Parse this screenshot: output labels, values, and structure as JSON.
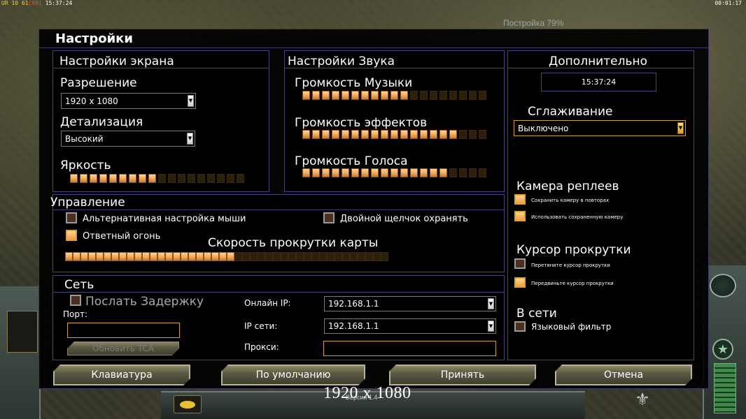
{
  "overlay": {
    "status_prefix": "UR",
    "status_val_a": "10",
    "status_val_b": "61",
    "status_val_c": "[60]",
    "status_clock": "15:37:24",
    "game_timer": "00:01:17",
    "build_status": "Постройка 79%",
    "version_text": "Версия 1.4",
    "resolution_caption": "1920 x 1080"
  },
  "dialog": {
    "title": "Настройки"
  },
  "screen": {
    "title": "Настройки экрана",
    "resolution_label": "Разрешение",
    "resolution_value": "1920 x 1080",
    "detail_label": "Детализация",
    "detail_value": "Высокий",
    "brightness_label": "Яркость",
    "brightness_level": 0.5
  },
  "sound": {
    "title": "Настройки Звука",
    "music_label": "Громкость Музыки",
    "music_level": 0.58,
    "effects_label": "Громкость эффектов",
    "effects_level": 0.84,
    "voice_label": "Громкость Голоса",
    "voice_level": 0.79
  },
  "advanced": {
    "title": "Дополнительно",
    "clock": "15:37:24",
    "antialias_label": "Сглаживание",
    "antialias_value": "Выключено",
    "replay_camera_title": "Камера реплеев",
    "replay_save_label": "Сохранить камеру в повторах",
    "replay_use_label": "Использовать сохраненную камеру",
    "scroll_cursor_title": "Курсор прокрутки",
    "scroll_cursor_drag_label": "Перетяните курсор прокрутки",
    "scroll_cursor_move_label": "Передвиньте курсор прокрутки",
    "online_title": "В сети",
    "language_filter_label": "Языковый фильтр"
  },
  "controls": {
    "title": "Управление",
    "alt_mouse_label": "Альтернативная настройка мыши",
    "double_click_label": "Двойной щелчок охранять",
    "return_fire_label": "Ответный огонь",
    "scroll_speed_label": "Скорость прокрутки карты",
    "scroll_speed_level": 0.52
  },
  "network": {
    "title": "Сеть",
    "send_delay_label": "Послать Задержку",
    "port_label": "Порт:",
    "port_value": "",
    "update_tca_label": "Обновить TCA",
    "online_ip_label": "Онлайн IP:",
    "online_ip_value": "192.168.1.1",
    "lan_ip_label": "IP сети:",
    "lan_ip_value": "192.168.1.1",
    "proxy_label": "Прокси:",
    "proxy_value": ""
  },
  "buttons": {
    "keyboard": "Клавиатура",
    "defaults": "По умолчанию",
    "accept": "Принять",
    "cancel": "Отмена"
  }
}
